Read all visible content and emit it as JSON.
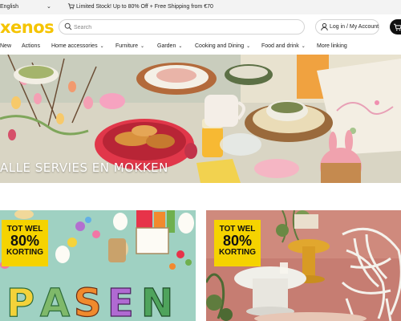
{
  "topbar": {
    "language": "English",
    "promo": "Limited Stock! Up to 80% Off + Free Shipping from €70"
  },
  "header": {
    "logo": "xenos",
    "search_placeholder": "Search",
    "account_label": "Log in / My Account"
  },
  "nav": {
    "items": [
      {
        "label": "New",
        "has_dropdown": false
      },
      {
        "label": "Actions",
        "has_dropdown": false
      },
      {
        "label": "Home accessories",
        "has_dropdown": true
      },
      {
        "label": "Furniture",
        "has_dropdown": true
      },
      {
        "label": "Garden",
        "has_dropdown": true
      },
      {
        "label": "Cooking and Dining",
        "has_dropdown": true
      },
      {
        "label": "Food and drink",
        "has_dropdown": true
      },
      {
        "label": "More linking",
        "has_dropdown": false
      }
    ]
  },
  "hero": {
    "caption": "ALLE SERVIES EN MOKKEN"
  },
  "tiles": [
    {
      "badge_line1": "TOT WEL",
      "badge_line2": "80%",
      "badge_line3": "KORTING",
      "word": "PASEN"
    },
    {
      "badge_line1": "TOT WEL",
      "badge_line2": "80%",
      "badge_line3": "KORTING"
    }
  ],
  "colors": {
    "brand_yellow": "#f5c400",
    "badge_yellow": "#f5d300",
    "cart_black": "#111111"
  }
}
